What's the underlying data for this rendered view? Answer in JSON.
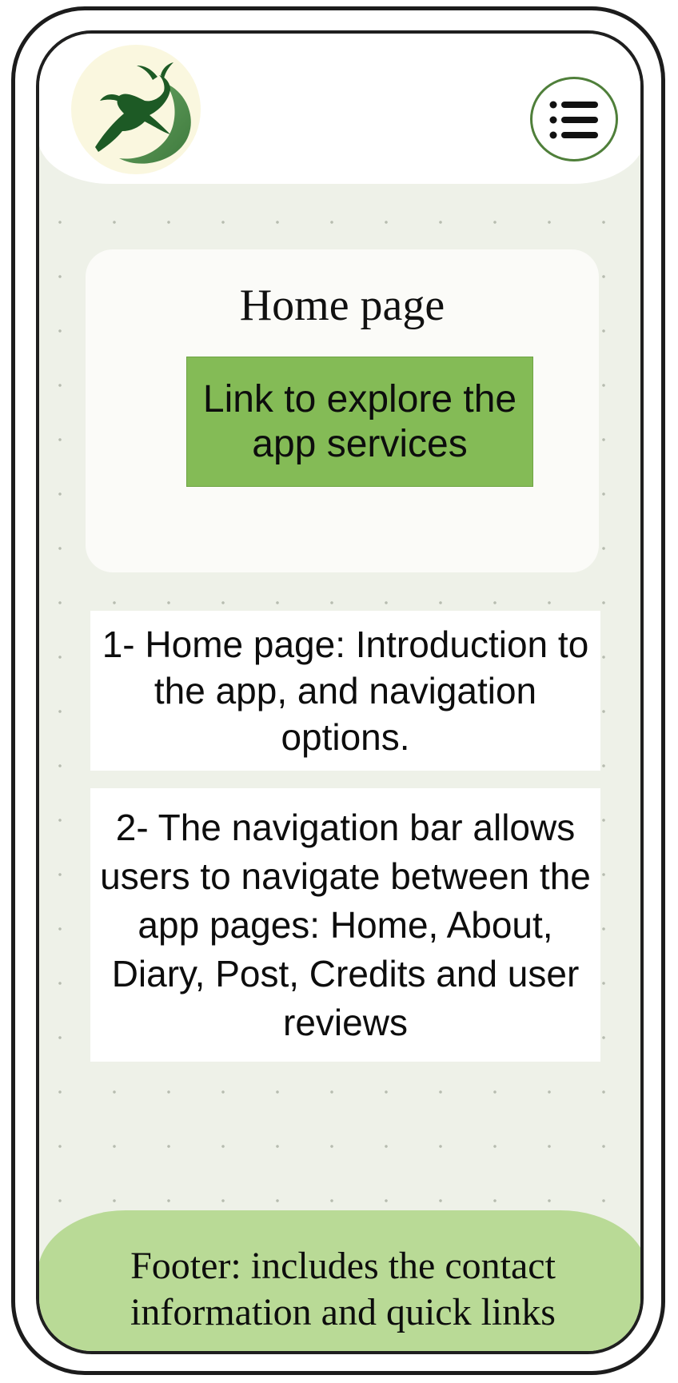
{
  "header": {
    "logo": {
      "icon": "leaping-deer-logo",
      "colors": {
        "deer": "#1d5a25",
        "crescent": "#4c8a4a",
        "background": "#faf7df"
      }
    },
    "menu_button": {
      "icon": "menu-list-icon",
      "color": "#4f7f3a"
    }
  },
  "hero": {
    "title": "Home page",
    "link_label": "Link to explore the app services",
    "link_color": "#84bb56"
  },
  "notes": [
    {
      "text": "1- Home page: Introduction to the app, and navigation options."
    },
    {
      "text": "2- The navigation bar allows users to navigate between the app pages: Home, About, Diary, Post, Credits and user reviews"
    }
  ],
  "footer": {
    "text": "Footer: includes the contact information and quick links",
    "color": "#b9da96"
  }
}
